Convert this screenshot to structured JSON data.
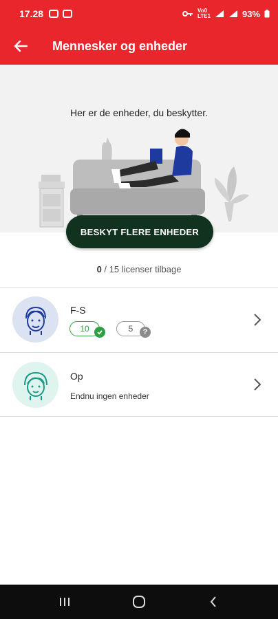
{
  "status_bar": {
    "time": "17.28",
    "network_top": "Vo0",
    "network_bottom": "LTE1",
    "battery": "93%"
  },
  "app_bar": {
    "title": "Mennesker og enheder",
    "back_icon": "arrow-left-icon"
  },
  "hero": {
    "text": "Her er de enheder, du beskytter."
  },
  "cta": {
    "label": "BESKYT FLERE ENHEDER"
  },
  "licenses": {
    "used": "0",
    "separator": " / ",
    "total": "15",
    "suffix": " licenser tilbage"
  },
  "people": [
    {
      "name": "F-S",
      "avatar": "boy-face-icon",
      "avatar_bg": "#dbe3f3",
      "protected_count": "10",
      "unprotected_count": "5",
      "protected_icon": "check-icon",
      "unprotected_icon": "question-icon"
    },
    {
      "name": "Op",
      "avatar": "child-face-icon",
      "avatar_bg": "#dff3ef",
      "subtitle": "Endnu ingen enheder"
    }
  ],
  "colors": {
    "brand_red": "#e8262c",
    "cta_dark_green": "#10321f",
    "success_green": "#2ea043"
  }
}
